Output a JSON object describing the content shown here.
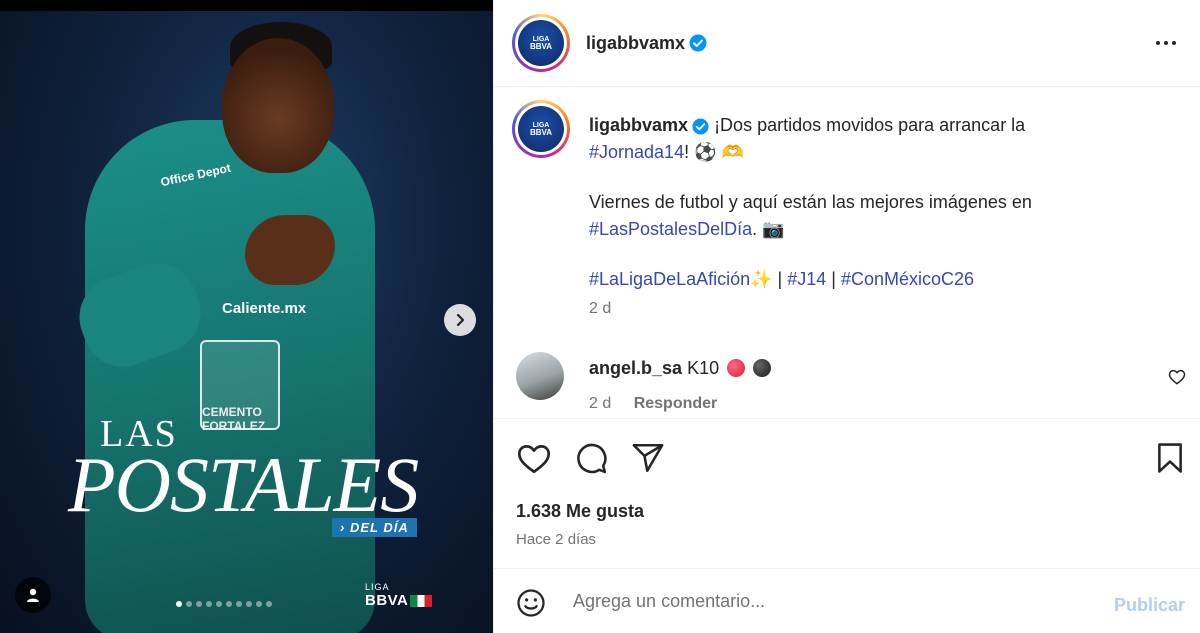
{
  "header": {
    "username": "ligabbvamx",
    "avatar_text_top": "LIGA",
    "avatar_text_bottom": "BBVA"
  },
  "caption": {
    "username": "ligabbvamx",
    "line1_text": "¡Dos partidos movidos para arrancar la",
    "line2_hashtag": "#Jornada14",
    "line2_suffix": "!",
    "line2_emojis": "⚽ 🫶",
    "para2_text": "Viernes de futbol y aquí están las mejores imágenes en",
    "para2_hashtag": "#LasPostalesDelDía",
    "para2_suffix": ". 📷",
    "tag1": "#LaLigaDeLaAfición",
    "tag1_emoji": "✨",
    "sep1": " | ",
    "tag2": "#J14",
    "sep2": " | ",
    "tag3": "#ConMéxicoC26",
    "time": "2 d"
  },
  "comment": {
    "username": "angel.b_sa",
    "text": "K10",
    "time": "2 d",
    "reply_label": "Responder"
  },
  "stats": {
    "likes": "1.638 Me gusta",
    "ago": "Hace 2 días"
  },
  "composer": {
    "placeholder": "Agrega un comentario...",
    "publish_label": "Publicar"
  },
  "media": {
    "headline_small": "LAS",
    "headline_big": "POSTALES",
    "tagline": "› DEL DÍA",
    "brand_small": "LIGA",
    "brand_big": "BBVA",
    "shirt_sponsor_top": "Office Depot",
    "shirt_sponsor_mid": "Caliente.mx",
    "shirt_badge": "CEMENTO FORTALEZ",
    "carousel_count": 10,
    "carousel_active": 0
  },
  "colors": {
    "hashtag": "#3648b5",
    "publish_disabled": "#b3cdf5",
    "verified": "#0095f6"
  }
}
